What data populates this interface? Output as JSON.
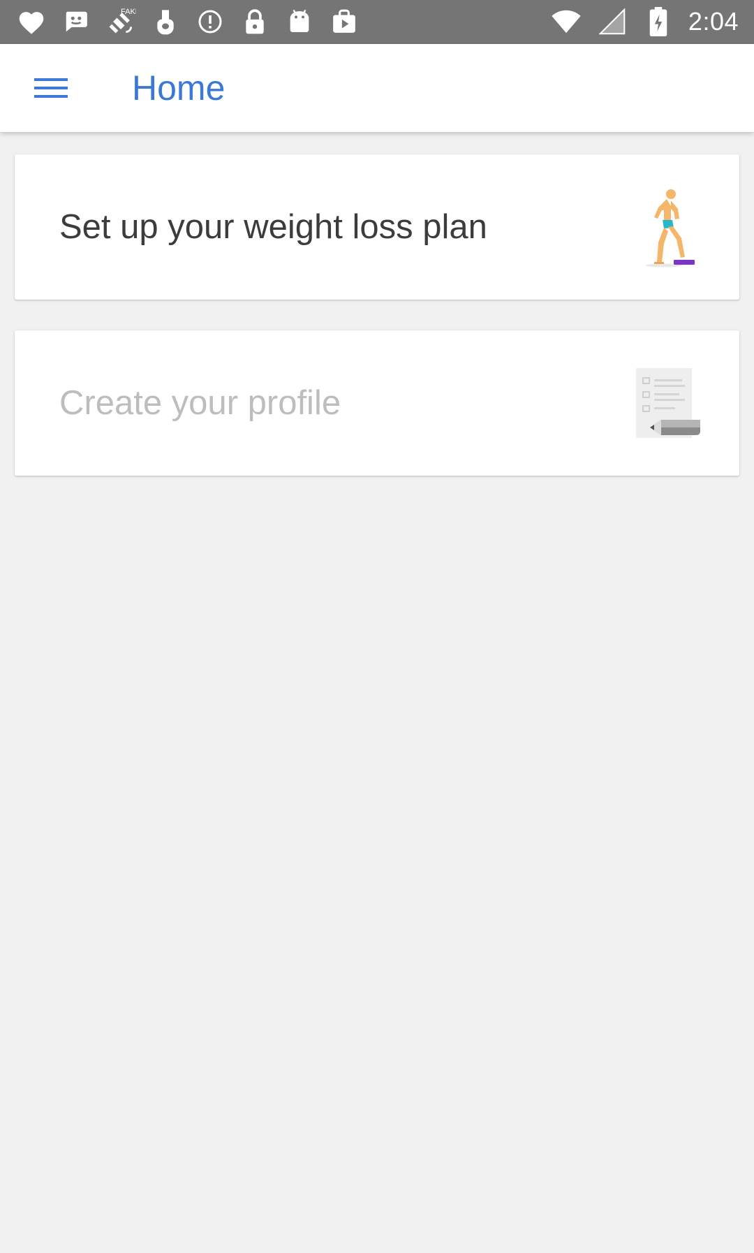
{
  "status_bar": {
    "time": "2:04",
    "left_icons": [
      "heart-icon",
      "chat-bubble-icon",
      "fake-gps-icon",
      "hand-icon",
      "info-circle-icon",
      "lock-icon",
      "android-robot-icon",
      "play-store-bag-icon"
    ],
    "right_icons": [
      "wifi-icon",
      "signal-icon",
      "battery-charging-icon"
    ]
  },
  "app_bar": {
    "menu_icon": "hamburger-menu-icon",
    "title": "Home"
  },
  "cards": [
    {
      "label": "Set up your weight loss plan",
      "illustration": "person-on-scale-illustration",
      "state": "enabled"
    },
    {
      "label": "Create your profile",
      "illustration": "document-with-pencil-illustration",
      "state": "disabled"
    }
  ],
  "colors": {
    "status_bar": "#757575",
    "app_bar": "#ffffff",
    "title": "#3b78d8",
    "background": "#f1f1f1",
    "card_text_enabled": "#3c3c3c",
    "card_text_disabled": "#bdbdbd"
  }
}
